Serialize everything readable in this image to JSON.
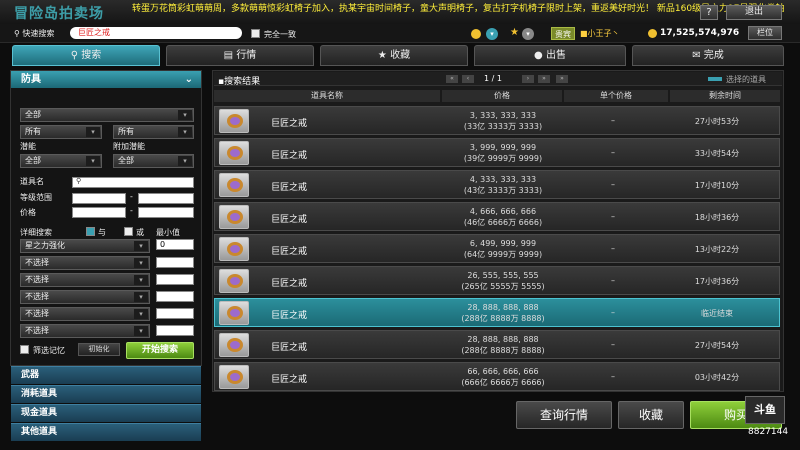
{
  "window": {
    "title": "冒险岛拍卖场",
    "marquee": "转蛋万花筒彩虹萌萌周，多款萌萌惊彩虹椅子加入，执某宇宙时间椅子，童大声明椅子，复古打字机椅子限时上架，重返美好时光！ 新品160级星之力17星强化卷轴",
    "help": "?",
    "exit": "退出"
  },
  "quick_search": {
    "label": "快速搜索",
    "value": "巨匠之戒",
    "exact_label": "完全一致",
    "vip": "贵宾",
    "player": "■小王子丶",
    "mesos": "17,525,574,976",
    "slot": "栏位"
  },
  "tabs": [
    {
      "label": "搜索",
      "icon": "search-icon"
    },
    {
      "label": "行情",
      "icon": "chart-icon"
    },
    {
      "label": "收藏",
      "icon": "star-icon"
    },
    {
      "label": "出售",
      "icon": "coin-icon"
    },
    {
      "label": "完成",
      "icon": "mail-icon"
    }
  ],
  "filters": {
    "category": "防具",
    "sub_all": "全部",
    "job_1": "所有",
    "job_2": "所有",
    "potential_label": "潜能",
    "extra_potential_label": "附加潜能",
    "potential": "全部",
    "extra_potential": "全部",
    "item_name_label": "道具名",
    "level_range_label": "等级范围",
    "range_sep": "-",
    "price_label": "价格",
    "detail_label": "详细搜索",
    "and_label": "与",
    "or_label": "或",
    "min_label": "最小值",
    "stat_1": "星之力强化",
    "stat_1_value": "0",
    "stat_none": "不选择",
    "remember_label": "筛选记忆",
    "reset_label": "初始化",
    "start_label": "开始搜索"
  },
  "categories": [
    "武器",
    "消耗道具",
    "现金道具",
    "其他道具"
  ],
  "results": {
    "title": "搜索结果",
    "page": "1 / 1",
    "selected_legend": "选择的道具",
    "columns": [
      "道具名称",
      "价格",
      "单个价格",
      "剩余时间"
    ],
    "rows": [
      {
        "name": "巨匠之戒",
        "price": "3, 333, 333, 333",
        "price_sub": "(33亿 3333万 3333)",
        "unit": "–",
        "time": "27小时53分"
      },
      {
        "name": "巨匠之戒",
        "price": "3, 999, 999, 999",
        "price_sub": "(39亿 9999万 9999)",
        "unit": "–",
        "time": "33小时54分"
      },
      {
        "name": "巨匠之戒",
        "price": "4, 333, 333, 333",
        "price_sub": "(43亿 3333万 3333)",
        "unit": "–",
        "time": "17小时10分"
      },
      {
        "name": "巨匠之戒",
        "price": "4, 666, 666, 666",
        "price_sub": "(46亿 6666万 6666)",
        "unit": "–",
        "time": "18小时36分"
      },
      {
        "name": "巨匠之戒",
        "price": "6, 499, 999, 999",
        "price_sub": "(64亿 9999万 9999)",
        "unit": "–",
        "time": "13小时22分"
      },
      {
        "name": "巨匠之戒",
        "price": "26, 555, 555, 555",
        "price_sub": "(265亿 5555万 5555)",
        "unit": "–",
        "time": "17小时36分"
      },
      {
        "name": "巨匠之戒",
        "price": "28, 888, 888, 888",
        "price_sub": "(288亿 8888万 8888)",
        "unit": "–",
        "time": "临近结束"
      },
      {
        "name": "巨匠之戒",
        "price": "28, 888, 888, 888",
        "price_sub": "(288亿 8888万 8888)",
        "unit": "–",
        "time": "27小时54分"
      },
      {
        "name": "巨匠之戒",
        "price": "66, 666, 666, 666",
        "price_sub": "(666亿 6666万 6666)",
        "unit": "–",
        "time": "03小时42分"
      }
    ]
  },
  "actions": {
    "market": "查询行情",
    "favorite": "收藏",
    "buy": "购买"
  },
  "overlay": {
    "logo": "斗鱼",
    "room": "8827144"
  },
  "colors": {
    "accent": "#3aa0b1",
    "marquee": "#ffef3a",
    "buy": "#7fc23a"
  }
}
